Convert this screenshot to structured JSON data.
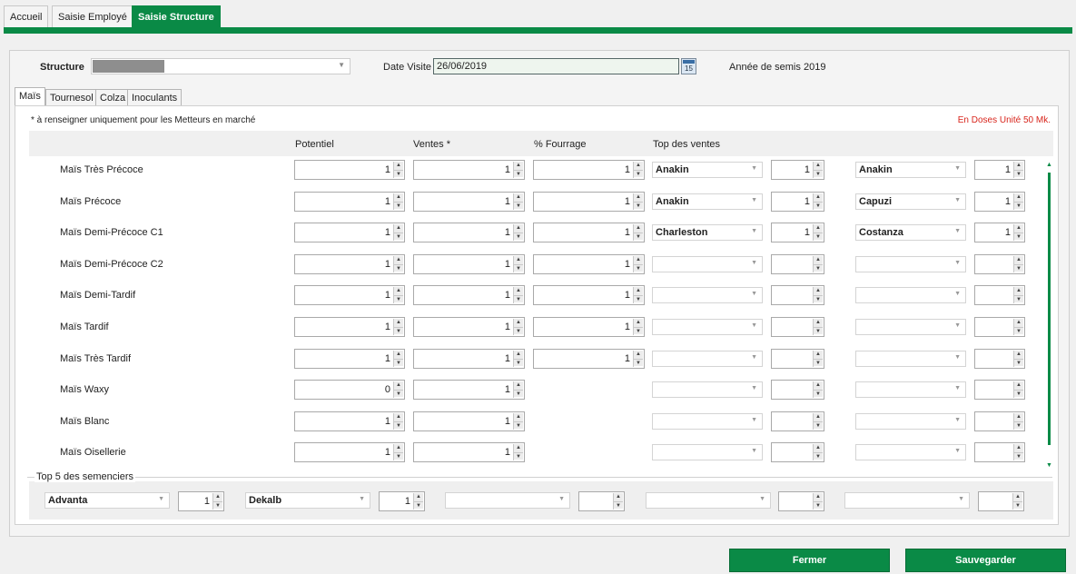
{
  "top_tabs": [
    "Accueil",
    "Saisie Employé",
    "Saisie Structure"
  ],
  "structure": {
    "label": "Structure",
    "date_label": "Date Visite",
    "date_value": "26/06/2019",
    "calendar_day": "15",
    "year_label": "Année de semis",
    "year_value": "2019"
  },
  "inner_tabs": [
    "Maïs",
    "Tournesol",
    "Colza",
    "Inoculants"
  ],
  "note": "* à renseigner uniquement pour les Metteurs en marché",
  "doses": "En Doses Unité 50 Mk.",
  "columns": {
    "potentiel": "Potentiel",
    "ventes": "Ventes *",
    "fourrage": "% Fourrage",
    "top": "Top des ventes"
  },
  "rows": [
    {
      "label": "Maïs Très Précoce",
      "potentiel": "1",
      "ventes": "1",
      "fourrage": "1",
      "top1": "Anakin",
      "top1_n": "1",
      "top2": "Anakin",
      "top2_n": "1"
    },
    {
      "label": "Maïs Précoce",
      "potentiel": "1",
      "ventes": "1",
      "fourrage": "1",
      "top1": "Anakin",
      "top1_n": "1",
      "top2": "Capuzi",
      "top2_n": "1"
    },
    {
      "label": "Maïs Demi-Précoce C1",
      "potentiel": "1",
      "ventes": "1",
      "fourrage": "1",
      "top1": "Charleston",
      "top1_n": "1",
      "top2": "Costanza",
      "top2_n": "1"
    },
    {
      "label": "Maïs Demi-Précoce C2",
      "potentiel": "1",
      "ventes": "1",
      "fourrage": "1",
      "top1": "",
      "top1_n": "",
      "top2": "",
      "top2_n": ""
    },
    {
      "label": "Maïs Demi-Tardif",
      "potentiel": "1",
      "ventes": "1",
      "fourrage": "1",
      "top1": "",
      "top1_n": "",
      "top2": "",
      "top2_n": ""
    },
    {
      "label": "Maïs Tardif",
      "potentiel": "1",
      "ventes": "1",
      "fourrage": "1",
      "top1": "",
      "top1_n": "",
      "top2": "",
      "top2_n": ""
    },
    {
      "label": "Maïs Très Tardif",
      "potentiel": "1",
      "ventes": "1",
      "fourrage": "1",
      "top1": "",
      "top1_n": "",
      "top2": "",
      "top2_n": ""
    },
    {
      "label": "Maïs Waxy",
      "potentiel": "0",
      "ventes": "1",
      "top1": "",
      "top1_n": "",
      "top2": "",
      "top2_n": ""
    },
    {
      "label": "Maïs Blanc",
      "potentiel": "1",
      "ventes": "1",
      "top1": "",
      "top1_n": "",
      "top2": "",
      "top2_n": ""
    },
    {
      "label": "Maïs Oisellerie",
      "potentiel": "1",
      "ventes": "1",
      "top1": "",
      "top1_n": "",
      "top2": "",
      "top2_n": ""
    }
  ],
  "top5": {
    "label": "Top 5 des semenciers",
    "items": [
      {
        "name": "Advanta",
        "value": "1"
      },
      {
        "name": "Dekalb",
        "value": "1"
      },
      {
        "name": "",
        "value": ""
      },
      {
        "name": "",
        "value": ""
      },
      {
        "name": "",
        "value": ""
      }
    ]
  },
  "buttons": {
    "close": "Fermer",
    "save": "Sauvegarder"
  },
  "icons": {
    "dropdown": "chevron-down-icon",
    "spin_up": "spin-up-icon",
    "spin_down": "spin-down-icon",
    "calendar": "calendar-icon"
  }
}
